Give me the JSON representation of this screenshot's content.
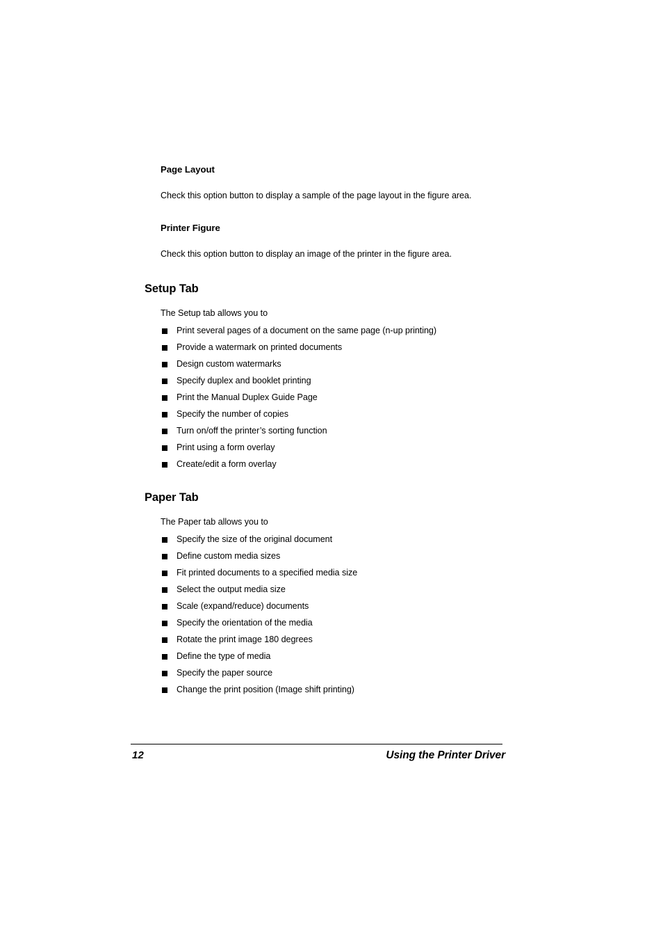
{
  "document": {
    "sections": [
      {
        "id": "page-layout",
        "level": 3,
        "heading": "Page Layout",
        "paragraph": "Check this option button to display a sample of the page layout in the figure area."
      },
      {
        "id": "printer-figure",
        "level": 3,
        "heading": "Printer Figure",
        "paragraph": "Check this option button to display an image of the printer in the figure area."
      },
      {
        "id": "setup-tab",
        "level": 2,
        "heading": "Setup Tab",
        "intro": "The Setup tab allows you to",
        "bullets": [
          "Print several pages of a document on the same page (n-up printing)",
          "Provide a watermark on printed documents",
          "Design custom watermarks",
          "Specify duplex and booklet printing",
          "Print the Manual Duplex Guide Page",
          "Specify the number of copies",
          "Turn on/off the printer’s sorting function",
          "Print using a form overlay",
          "Create/edit a form overlay"
        ]
      },
      {
        "id": "paper-tab",
        "level": 2,
        "heading": "Paper Tab",
        "intro": "The Paper tab allows you to",
        "bullets": [
          "Specify the size of the original document",
          "Define custom media sizes",
          "Fit printed documents to a specified media size",
          "Select the output media size",
          "Scale (expand/reduce) documents",
          "Specify the orientation of the media",
          "Rotate the print image 180 degrees",
          "Define the type of media",
          "Specify the paper source",
          "Change the print position (Image shift printing)"
        ]
      }
    ]
  },
  "footer": {
    "page_number": "12",
    "running_title": "Using the Printer Driver"
  },
  "colors": {
    "page_background": "#ffffff",
    "text": "#000000",
    "bullet_marker": "#000000",
    "footer_rule": "#000000"
  }
}
